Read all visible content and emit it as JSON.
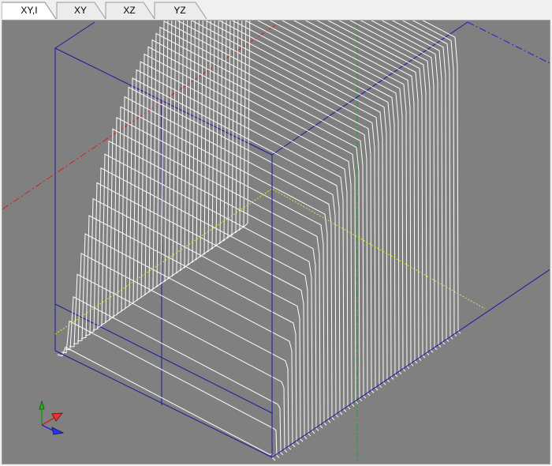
{
  "tabs": [
    {
      "label": "XY,I",
      "active": true
    },
    {
      "label": "XY",
      "active": false
    },
    {
      "label": "XZ",
      "active": false
    },
    {
      "label": "YZ",
      "active": false
    }
  ],
  "colors": {
    "viewport_bg": "#808080",
    "bounding_box": "#1a1aa0",
    "surface_lines": "#ffffff",
    "x_axis_line": "#d02020",
    "y_axis_line": "#20a020",
    "z_axis_line": "#2020d0",
    "baseline": "#e8e820"
  },
  "view": {
    "type": "3d-isometric-waterfall",
    "triad_icons": [
      "axis-y-arrow-icon",
      "axis-x-arrow-icon",
      "axis-z-arrow-icon"
    ]
  }
}
